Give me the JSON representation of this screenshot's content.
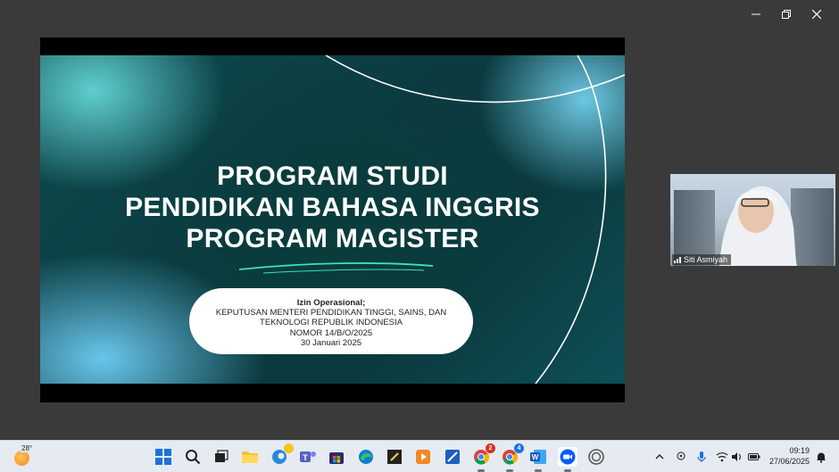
{
  "window": {
    "controls": [
      "minimize",
      "restore",
      "close"
    ]
  },
  "slide": {
    "title_lines": [
      "PROGRAM STUDI",
      "PENDIDIKAN BAHASA INGGRIS",
      "PROGRAM MAGISTER"
    ],
    "info_label": "Izin Operasional;",
    "info_lines": [
      "KEPUTUSAN MENTERI PENDIDIKAN TINGGI, SAINS, DAN",
      "TEKNOLOGI REPUBLIK INDONESIA",
      "NOMOR 14/B/O/2025",
      "30 Januari 2025"
    ],
    "colors": {
      "dark_teal": "#0b3b40",
      "light_cyan": "#6ed0f2",
      "accent_green": "#3ee0b8"
    }
  },
  "participant": {
    "name": "Siti Asmiyah"
  },
  "taskbar": {
    "weather_temp": "28°",
    "apps": [
      {
        "name": "start-icon"
      },
      {
        "name": "search-icon"
      },
      {
        "name": "task-view-icon"
      },
      {
        "name": "file-explorer-icon"
      },
      {
        "name": "edge-legacy-icon"
      },
      {
        "name": "teams-icon"
      },
      {
        "name": "store-icon"
      },
      {
        "name": "edge-icon"
      },
      {
        "name": "sticky-notes-icon"
      },
      {
        "name": "media-player-icon"
      },
      {
        "name": "paint-icon"
      },
      {
        "name": "chrome-icon",
        "badge": "2"
      },
      {
        "name": "chrome-profile-icon",
        "badge": "4"
      },
      {
        "name": "word-icon"
      },
      {
        "name": "zoom-icon"
      },
      {
        "name": "obs-icon"
      }
    ],
    "tray_icons": [
      "chevron-up-icon",
      "location-icon",
      "microphone-icon",
      "wifi-icon",
      "volume-icon",
      "battery-icon"
    ],
    "time": "09:19",
    "date": "27/06/2025",
    "notification_icon": "notification-bell-icon"
  }
}
